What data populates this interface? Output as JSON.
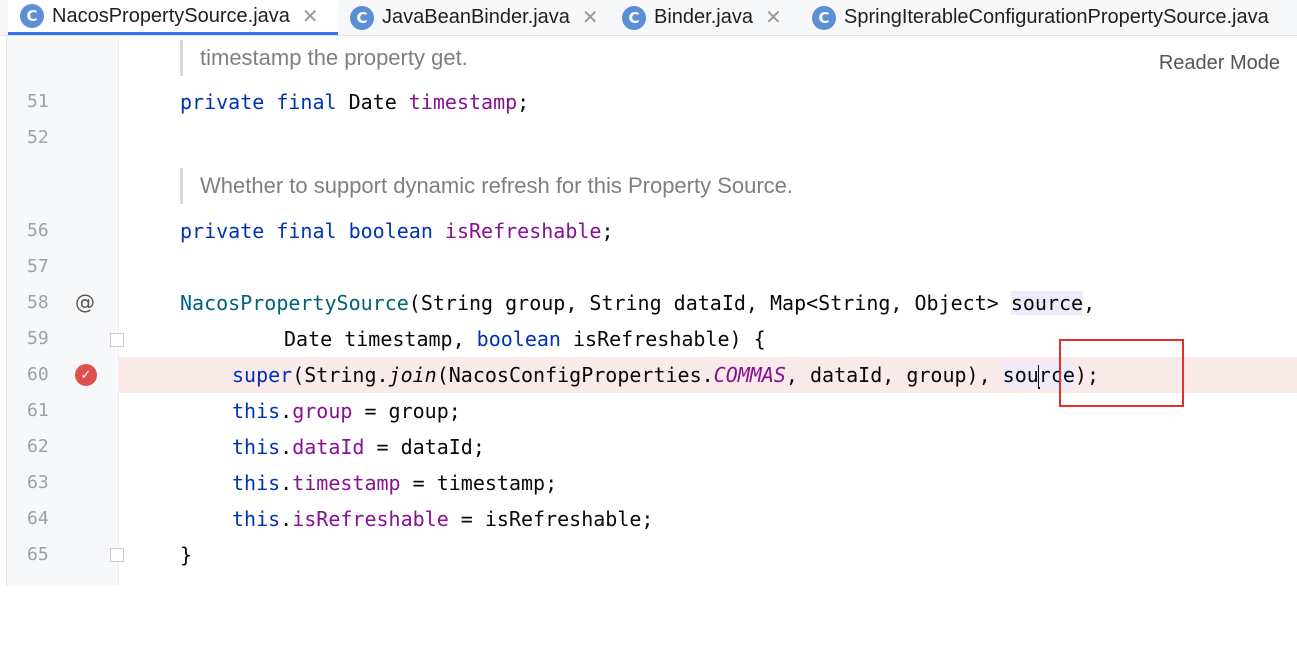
{
  "tabs": [
    {
      "label": "NacosPropertySource.java",
      "icon": "class-icon",
      "icon_letter": "C",
      "active": true,
      "close": "✕"
    },
    {
      "label": "JavaBeanBinder.java",
      "icon": "class-icon",
      "icon_letter": "C",
      "active": false,
      "close": "✕"
    },
    {
      "label": "Binder.java",
      "icon": "class-icon",
      "icon_letter": "C",
      "active": false,
      "close": "✕"
    },
    {
      "label": "SpringIterableConfigurationPropertySource.java",
      "icon": "class-icon",
      "icon_letter": "C",
      "active": false
    }
  ],
  "reader_mode": "Reader Mode",
  "gutter": {
    "line_numbers": [
      "51",
      "52",
      "56",
      "57",
      "58",
      "59",
      "60",
      "61",
      "62",
      "63",
      "64",
      "65"
    ],
    "override_marker": "@",
    "breakpoint_line": "60",
    "breakpoint_glyph": "✓"
  },
  "docs": {
    "timestamp": "timestamp the property get.",
    "refreshable": "Whether to support dynamic refresh for this Property Source."
  },
  "code": {
    "l51": {
      "kw": "private final ",
      "type": "Date ",
      "field": "timestamp",
      "end": ";"
    },
    "l56": {
      "kw": "private final boolean ",
      "field": "isRefreshable",
      "end": ";"
    },
    "l58": {
      "fn": "NacosPropertySource",
      "params": "(String group, String dataId, Map<String, Object> ",
      "hl": "source",
      "end": ","
    },
    "l59": {
      "pre": "Date timestamp, ",
      "kw": "boolean",
      "post": " isRefreshable) {"
    },
    "l60": {
      "kw": "super",
      "a": "(String.",
      "it": "join",
      "b": "(NacosConfigProperties.",
      "const": "COMMAS",
      "c": ", dataId, group), ",
      "hl1": "sou",
      "hl2": "rce",
      "end": ");"
    },
    "l61": {
      "kw": "this",
      "dot": ".",
      "field": "group",
      "rest": " = group;"
    },
    "l62": {
      "kw": "this",
      "dot": ".",
      "field": "dataId",
      "rest": " = dataId;"
    },
    "l63": {
      "kw": "this",
      "dot": ".",
      "field": "timestamp",
      "rest": " = timestamp;"
    },
    "l64": {
      "kw": "this",
      "dot": ".",
      "field": "isRefreshable",
      "rest": " = isRefreshable;"
    },
    "l65": {
      "brace": "}"
    }
  },
  "colors": {
    "keyword": "#0033b3",
    "field": "#871094",
    "function": "#00627a",
    "breakpoint": "#e0504f",
    "annotation_box": "#e03030"
  }
}
